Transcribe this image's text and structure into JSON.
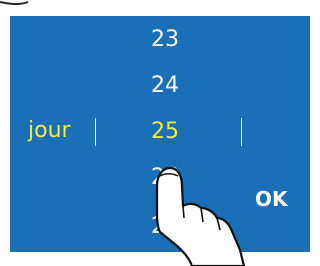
{
  "picker": {
    "label": "jour",
    "values": [
      "23",
      "24",
      "25",
      "26",
      "27"
    ],
    "selected": "25"
  },
  "ok_label": "OK",
  "colors": {
    "panel": "#1a6fb6",
    "accent": "#f2ec3a",
    "text": "#ffffff"
  },
  "icons": {
    "pointer": "tap-hand-icon"
  }
}
